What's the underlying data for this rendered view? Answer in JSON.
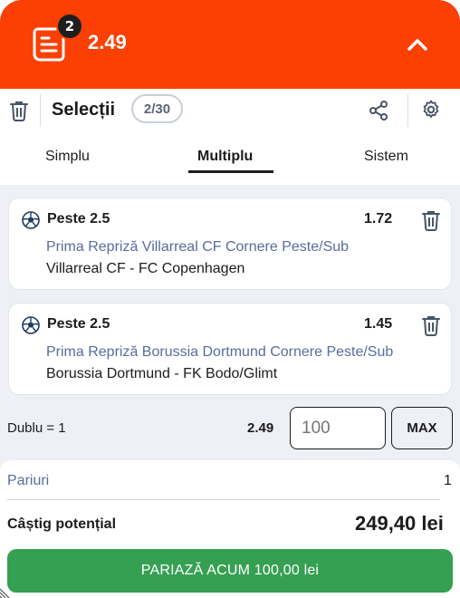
{
  "header": {
    "badge_count": "2",
    "total_odds": "2.49",
    "accent_color": "#fc3f03",
    "receipt_icon": "receipt-icon",
    "collapse_icon": "chevron-up-icon"
  },
  "toolbar": {
    "title": "Selecții",
    "count": "2/30",
    "trash_icon": "trash-icon",
    "share_icon": "share-icon",
    "settings_icon": "gear-icon"
  },
  "tabs": [
    {
      "label": "Simplu",
      "active": false
    },
    {
      "label": "Multiplu",
      "active": true
    },
    {
      "label": "Sistem",
      "active": false
    }
  ],
  "selections": [
    {
      "market": "Peste 2.5",
      "odd": "1.72",
      "description": "Prima Repriză Villarreal CF Cornere Peste/Sub",
      "match": "Villarreal CF - FC Copenhagen"
    },
    {
      "market": "Peste 2.5",
      "odd": "1.45",
      "description": "Prima Repriză Borussia Dortmund Cornere Peste/Sub",
      "match": "Borussia Dortmund - FK Bodo/Glimt"
    }
  ],
  "stake": {
    "label": "Dublu = 1",
    "odds": "2.49",
    "placeholder": "100",
    "max_label": "MAX"
  },
  "summary": {
    "bets_label": "Pariuri",
    "bets_value": "1",
    "potential_label": "Câștig potențial",
    "potential_value": "249,40 lei",
    "place_button": "PARIAZĂ ACUM 100,00 lei",
    "button_color": "#36a052"
  }
}
